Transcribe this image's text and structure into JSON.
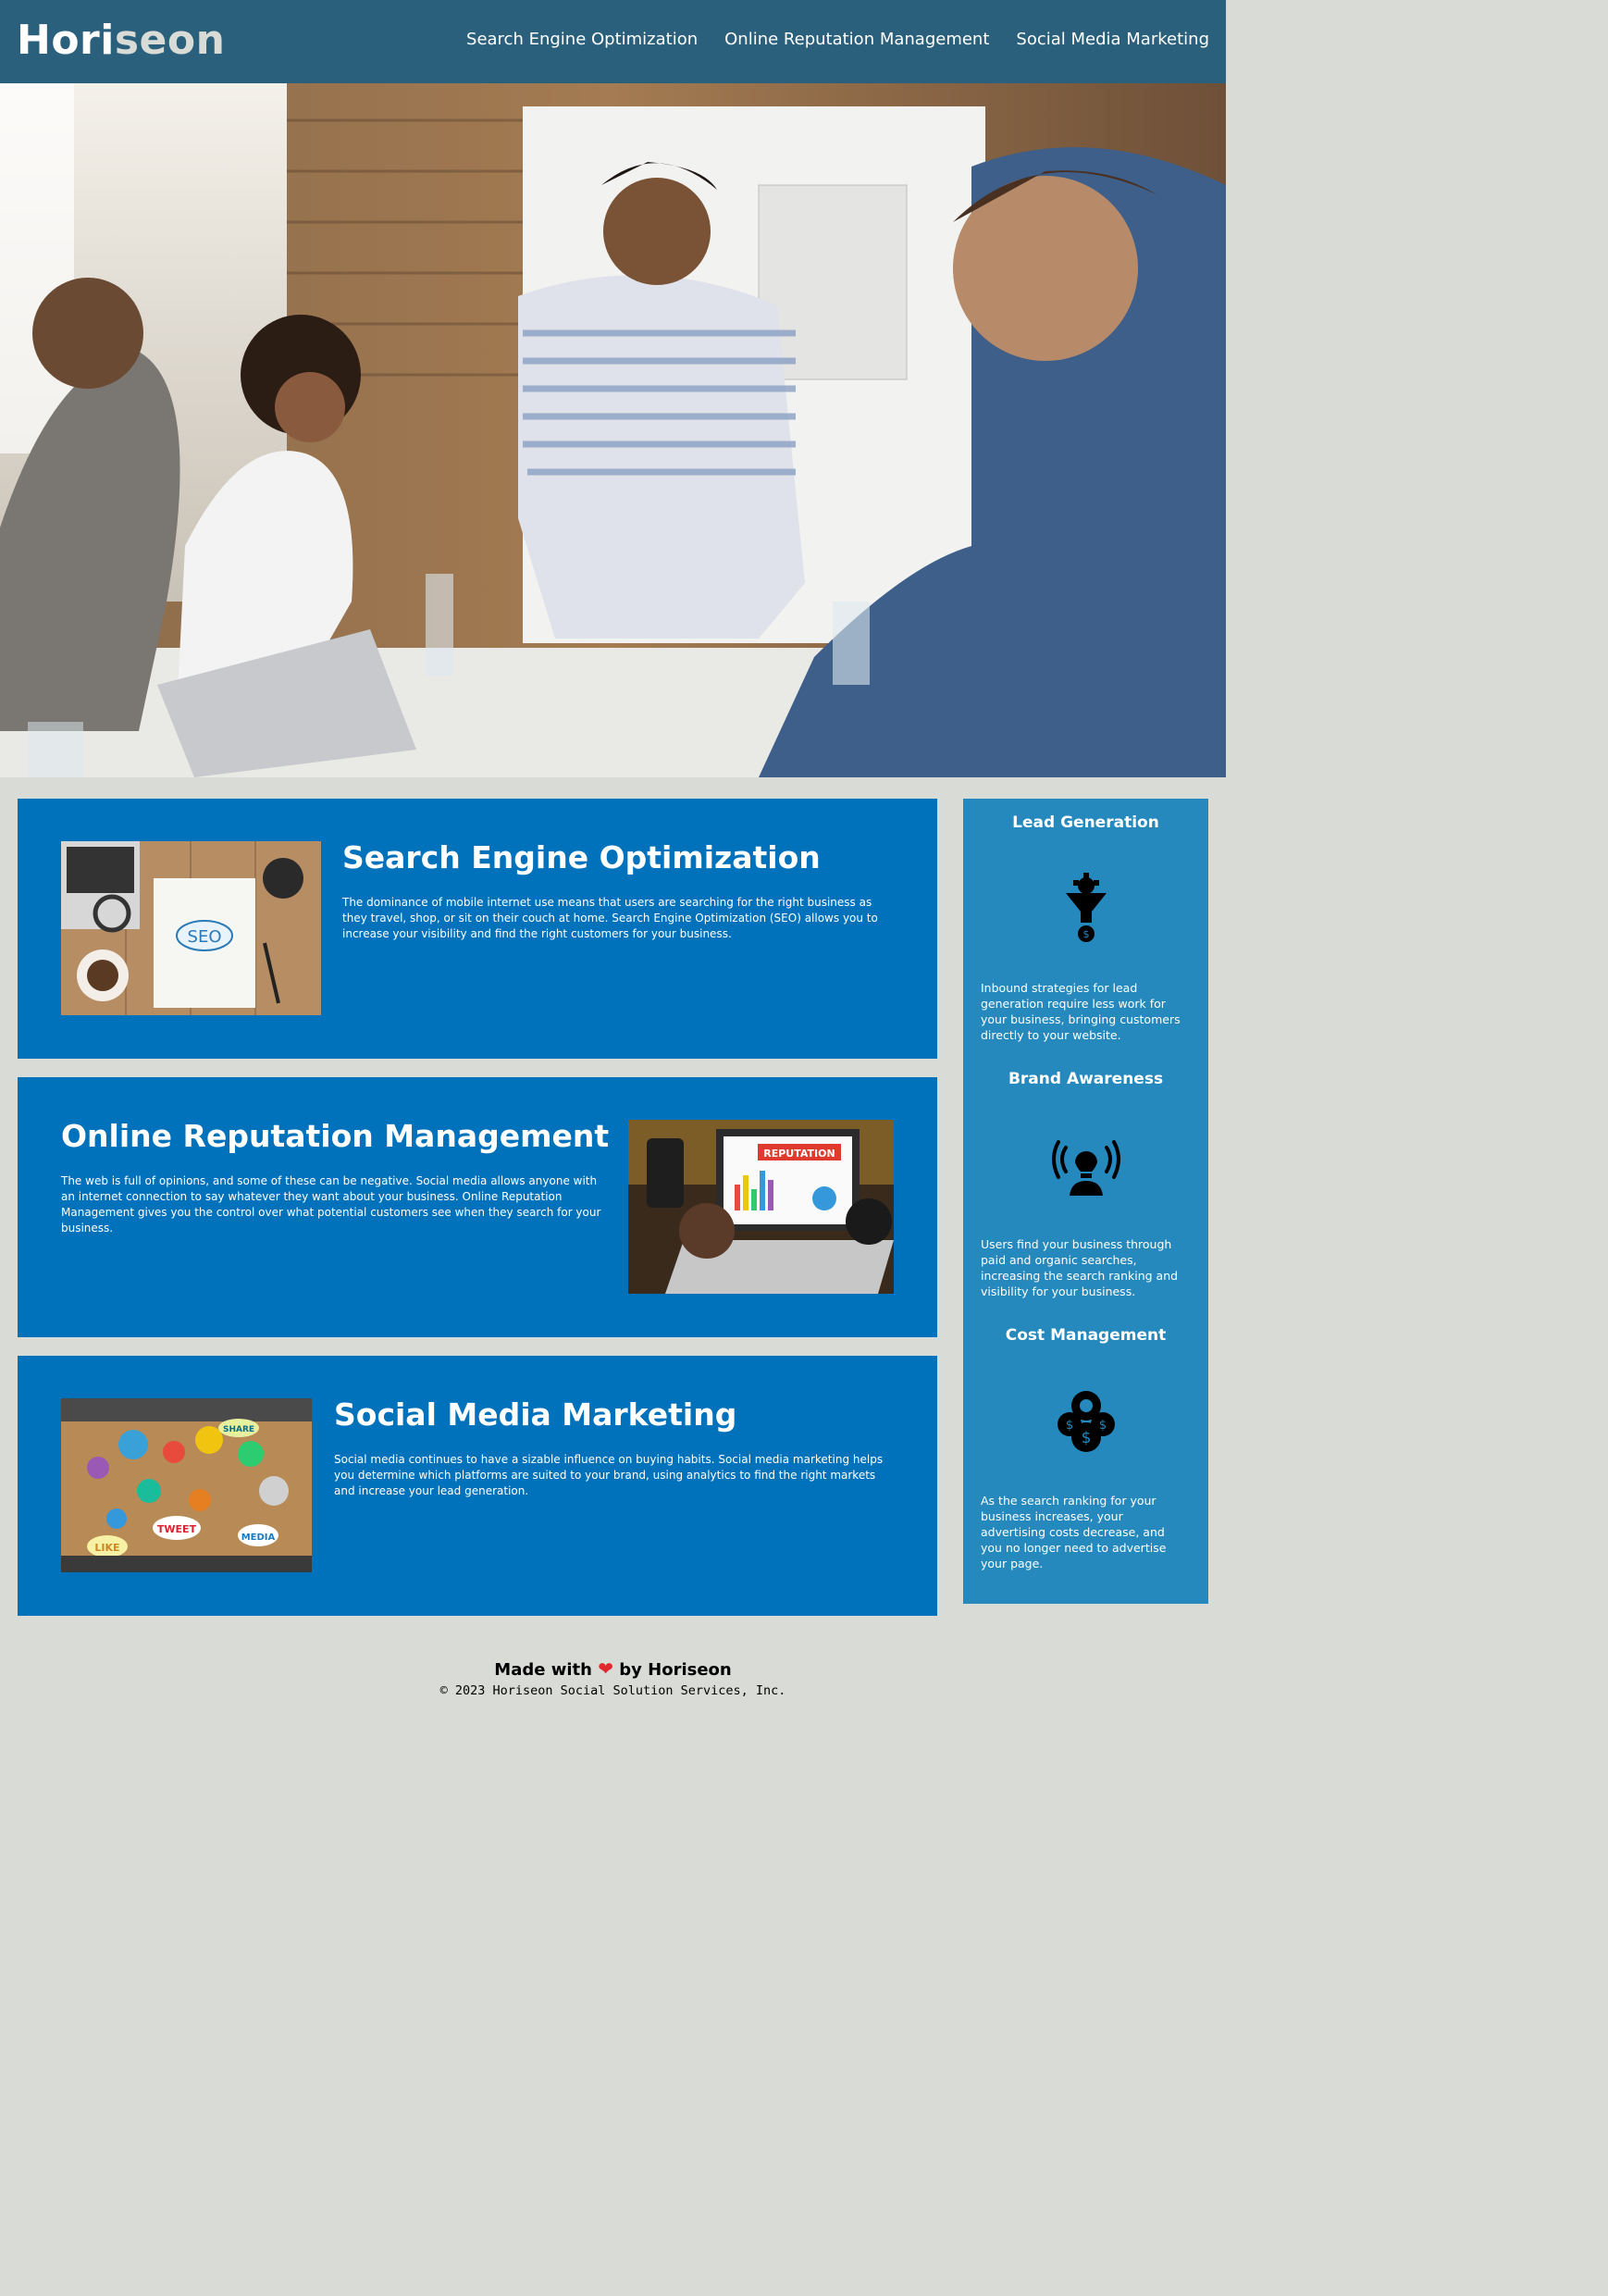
{
  "header": {
    "logo_prefix": "Hori",
    "logo_suffix": "seon",
    "nav": [
      {
        "label": "Search Engine Optimization"
      },
      {
        "label": "Online Reputation Management"
      },
      {
        "label": "Social Media Marketing"
      }
    ]
  },
  "hero": {
    "alt": "People working together in a meeting"
  },
  "sections": [
    {
      "title": "Search Engine Optimization",
      "text": "The dominance of mobile internet use means that users are searching for the right business as they travel, shop, or sit on their couch at home. Search Engine Optimization (SEO) allows you to increase your visibility and find the right customers for your business.",
      "image_label": "SEO"
    },
    {
      "title": "Online Reputation Management",
      "text": "The web is full of opinions, and some of these can be negative. Social media allows anyone with an internet connection to say whatever they want about your business. Online Reputation Management gives you the control over what potential customers see when they search for your business.",
      "image_label": "REPUTATION"
    },
    {
      "title": "Social Media Marketing",
      "text": "Social media continues to have a sizable influence on buying habits. Social media marketing helps you determine which platforms are suited to your brand, using analytics to find the right markets and increase your lead generation.",
      "image_labels": [
        "TWEET",
        "LIKE",
        "MEDIA",
        "SHARE"
      ]
    }
  ],
  "benefits": [
    {
      "title": "Lead Generation",
      "icon": "lead-funnel-icon",
      "text": "Inbound strategies for lead generation require less work for your business, bringing customers directly to your website."
    },
    {
      "title": "Brand Awareness",
      "icon": "lightbulb-broadcast-icon",
      "text": "Users find your business through paid and organic searches, increasing the search ranking and visibility for your business."
    },
    {
      "title": "Cost Management",
      "icon": "coins-gear-icon",
      "text": "As the search ranking for your business increases, your advertising costs decrease, and you no longer need to advertise your page."
    }
  ],
  "footer": {
    "made_prefix": "Made with",
    "made_suffix": "by Horiseon",
    "heart": "❤",
    "copyright": "© 2023 Horiseon Social Solution Services, Inc."
  },
  "colors": {
    "header_bg": "#2a607c",
    "page_bg": "#d9dcd6",
    "card_bg": "#0072bb",
    "sidebar_bg": "#2589bd"
  }
}
